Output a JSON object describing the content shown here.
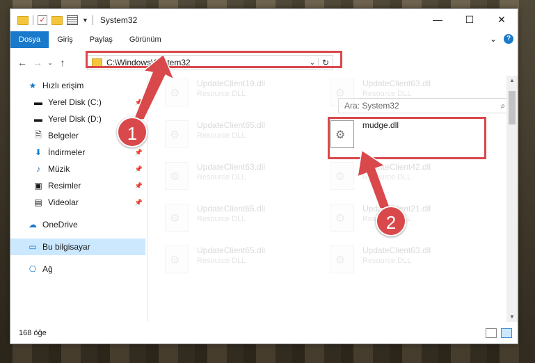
{
  "window": {
    "title": "System32",
    "controls": {
      "minimize": "—",
      "maximize": "☐",
      "close": "✕"
    }
  },
  "ribbon": {
    "tabs": [
      "Dosya",
      "Giriş",
      "Paylaş",
      "Görünüm"
    ],
    "active_tab": "Dosya"
  },
  "address": {
    "path": "C:\\Windows\\System32"
  },
  "search": {
    "placeholder": "Ara: System32"
  },
  "nav": {
    "quick_access": "Hızlı erişim",
    "items": [
      {
        "label": "Yerel Disk (C:)",
        "icon": "drive-icon",
        "pinned": true
      },
      {
        "label": "Yerel Disk (D:)",
        "icon": "drive-icon",
        "pinned": false
      },
      {
        "label": "Belgeler",
        "icon": "documents-icon",
        "pinned": true
      },
      {
        "label": "İndirmeler",
        "icon": "downloads-icon",
        "pinned": true
      },
      {
        "label": "Müzik",
        "icon": "music-icon",
        "pinned": true
      },
      {
        "label": "Resimler",
        "icon": "pictures-icon",
        "pinned": true
      },
      {
        "label": "Videolar",
        "icon": "videos-icon",
        "pinned": true
      }
    ],
    "onedrive": "OneDrive",
    "this_pc": "Bu bilgisayar",
    "network": "Ağ"
  },
  "files": [
    {
      "name": "UpdateClient19.dll",
      "type": "Resource DLL"
    },
    {
      "name": "UpdateClient63.dll",
      "type": "Resource DLL"
    },
    {
      "name": "UpdateClient65.dll",
      "type": "Resource DLL"
    },
    {
      "name": "mudge.dll",
      "type": ""
    },
    {
      "name": "UpdateClient63.dll",
      "type": "Resource DLL"
    },
    {
      "name": "UpdateClient42.dll",
      "type": "Resource DLL"
    },
    {
      "name": "UpdateClient65.dll",
      "type": "Resource DLL"
    },
    {
      "name": "UpdateClient21.dll",
      "type": "Resource DLL"
    },
    {
      "name": "UpdateClient65.dll",
      "type": "Resource DLL"
    },
    {
      "name": "UpdateClient63.dll",
      "type": "Resource DLL"
    }
  ],
  "status": {
    "count": "168 öğe"
  },
  "annotations": {
    "step1": "1",
    "step2": "2",
    "color": "#d9484b"
  }
}
